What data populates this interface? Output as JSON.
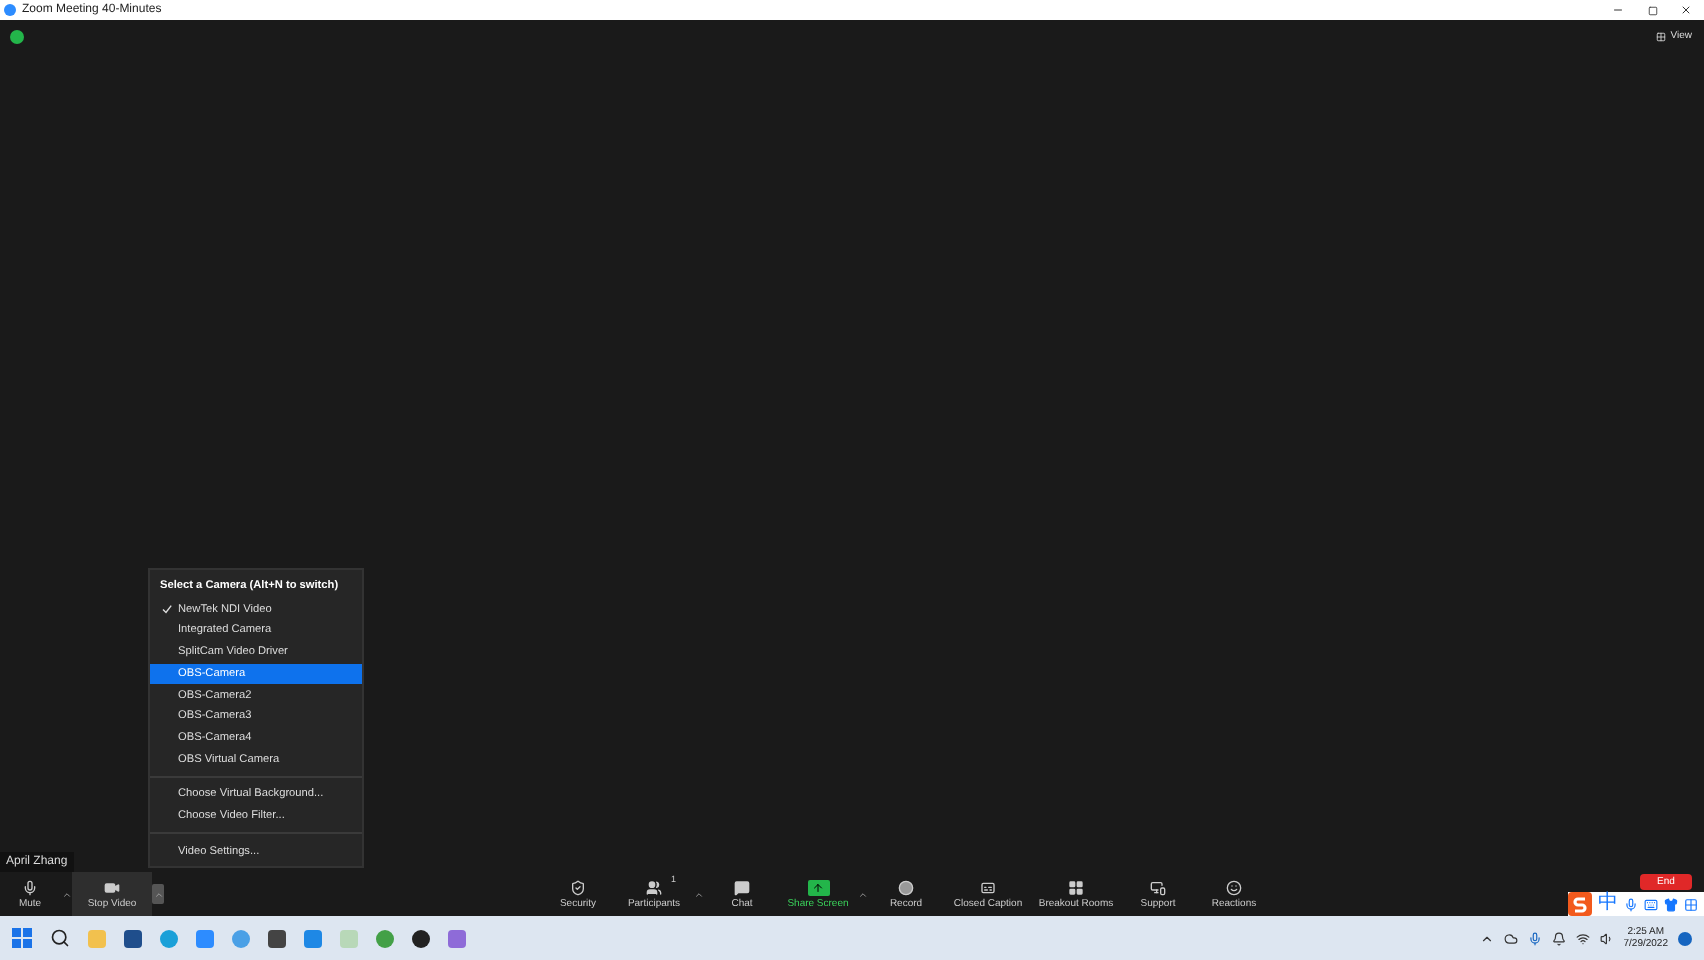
{
  "window": {
    "title": "Zoom Meeting 40-Minutes"
  },
  "view_button": "View",
  "name_tag": "April Zhang",
  "camera_menu": {
    "title": "Select a Camera (Alt+N to switch)",
    "sections": [
      [
        {
          "label": "NewTek NDI Video",
          "checked": true,
          "selected": false
        },
        {
          "label": "Integrated Camera",
          "checked": false,
          "selected": false
        },
        {
          "label": "SplitCam Video Driver",
          "checked": false,
          "selected": false
        },
        {
          "label": "OBS-Camera",
          "checked": false,
          "selected": true
        },
        {
          "label": "OBS-Camera2",
          "checked": false,
          "selected": false
        },
        {
          "label": "OBS-Camera3",
          "checked": false,
          "selected": false
        },
        {
          "label": "OBS-Camera4",
          "checked": false,
          "selected": false
        },
        {
          "label": "OBS Virtual Camera",
          "checked": false,
          "selected": false
        }
      ],
      [
        {
          "label": "Choose Virtual Background...",
          "checked": false,
          "selected": false
        },
        {
          "label": "Choose Video Filter...",
          "checked": false,
          "selected": false
        }
      ],
      [
        {
          "label": "Video Settings...",
          "checked": false,
          "selected": false
        }
      ]
    ]
  },
  "toolbar": {
    "left": [
      {
        "kind": "mic",
        "label": "Mute",
        "caret": true,
        "menu_open": false
      },
      {
        "kind": "video",
        "label": "Stop Video",
        "caret": true,
        "menu_open": true
      }
    ],
    "center": [
      {
        "kind": "security",
        "label": "Security",
        "caret": false
      },
      {
        "kind": "participants",
        "label": "Participants",
        "caret": true,
        "badge": "1"
      },
      {
        "kind": "chat",
        "label": "Chat",
        "caret": false
      },
      {
        "kind": "share",
        "label": "Share Screen",
        "caret": true
      },
      {
        "kind": "record",
        "label": "Record",
        "caret": false
      },
      {
        "kind": "caption",
        "label": "Closed Caption",
        "caret": false
      },
      {
        "kind": "rooms",
        "label": "Breakout Rooms",
        "caret": false
      },
      {
        "kind": "support",
        "label": "Support",
        "caret": false
      },
      {
        "kind": "reactions",
        "label": "Reactions",
        "caret": false
      }
    ],
    "end_button": "End"
  },
  "ime_bar": {
    "mode": "中"
  },
  "taskbar": {
    "time": "2:25 AM",
    "date": "7/29/2022"
  }
}
